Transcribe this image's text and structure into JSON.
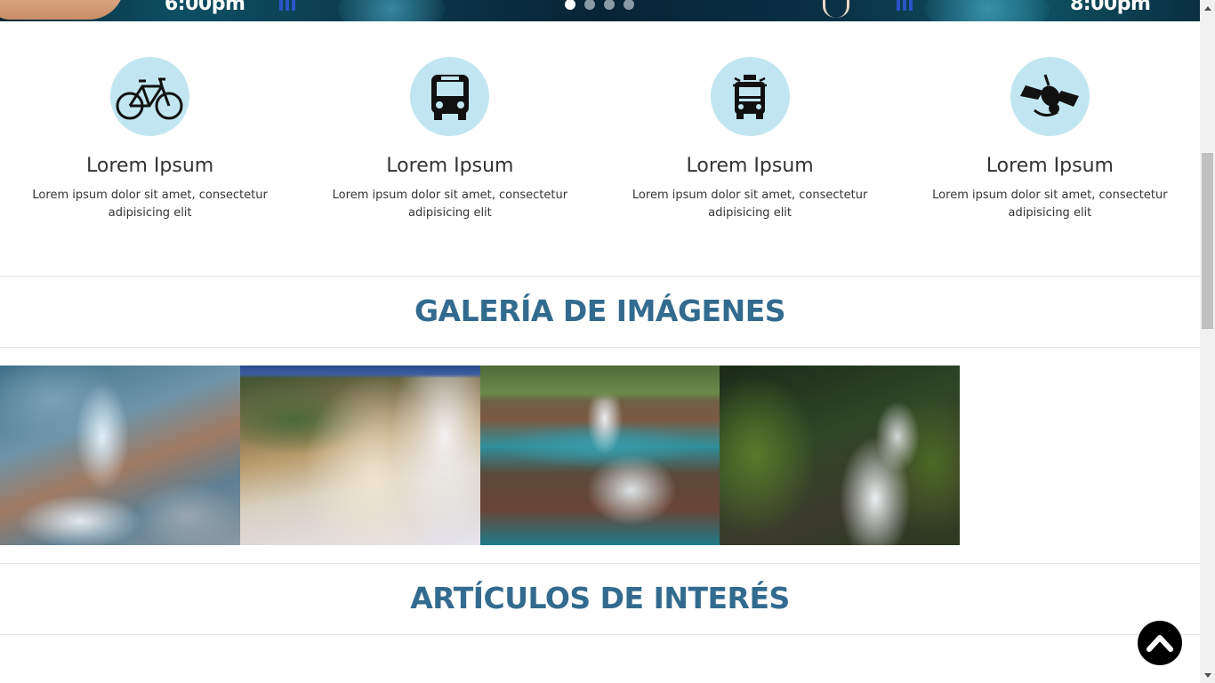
{
  "hero": {
    "left_time": "6:00pm",
    "right_time": "8:00pm",
    "slides": [
      {
        "label": "slide-1",
        "active": true
      },
      {
        "label": "slide-2",
        "active": false
      },
      {
        "label": "slide-3",
        "active": false
      },
      {
        "label": "slide-4",
        "active": false
      }
    ]
  },
  "features": [
    {
      "icon": "bicycle-icon",
      "title": "Lorem Ipsum",
      "text": "Lorem ipsum dolor sit amet, consectetur adipisicing elit"
    },
    {
      "icon": "bus-icon",
      "title": "Lorem Ipsum",
      "text": "Lorem ipsum dolor sit amet, consectetur adipisicing elit"
    },
    {
      "icon": "fire-truck-icon",
      "title": "Lorem Ipsum",
      "text": "Lorem ipsum dolor sit amet, consectetur adipisicing elit"
    },
    {
      "icon": "satellite-icon",
      "title": "Lorem Ipsum",
      "text": "Lorem ipsum dolor sit amet, consectetur adipisicing elit"
    }
  ],
  "gallery": {
    "title": "GALERÍA DE IMÁGENES",
    "images": [
      "waterfall-image-1",
      "waterfall-image-2",
      "waterfall-image-3",
      "waterfall-image-4"
    ]
  },
  "articles": {
    "title": "ARTÍCULOS DE INTERÉS"
  },
  "back_to_top": {
    "icon": "chevron-up-icon"
  },
  "colors": {
    "heading": "#336b8f",
    "icon_circle": "#c1e6f1"
  }
}
